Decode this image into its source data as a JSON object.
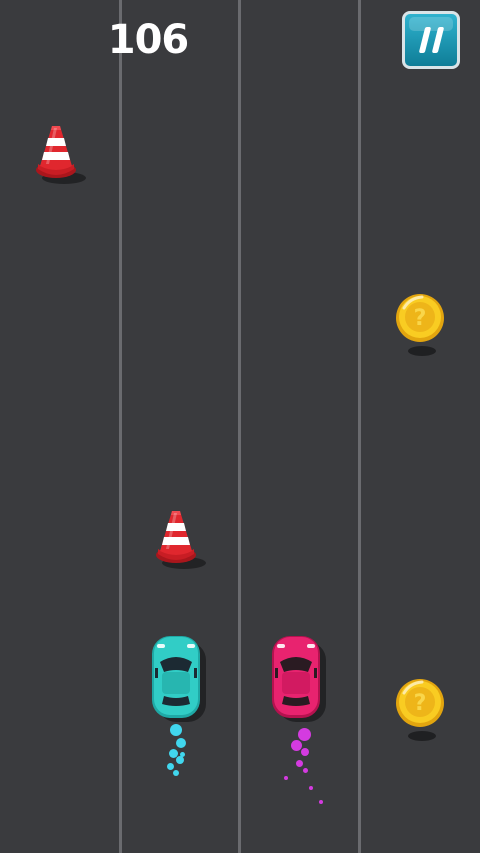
{
  "score": "106",
  "pause_button": {
    "icon": "pause-icon",
    "color": "#1a95b1"
  },
  "colors": {
    "road": "#3a3b3e",
    "lane_line": "#6a6b6f",
    "left_car": "#2ec9c4",
    "right_car": "#e8236f",
    "left_exhaust": "#41d7ee",
    "right_exhaust": "#d43be0",
    "coin": "#f4c21c",
    "cone": "#d6262b"
  },
  "items": {
    "cones": 2,
    "coins": 2,
    "cars": 2
  }
}
